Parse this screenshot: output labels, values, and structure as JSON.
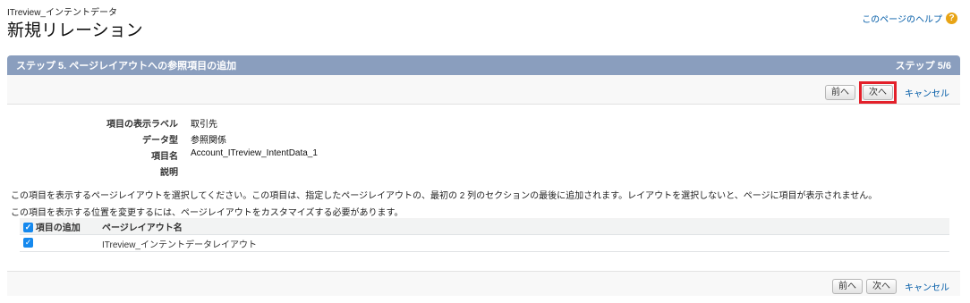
{
  "header": {
    "object_name": "ITreview_インテントデータ",
    "title": "新規リレーション",
    "help_link": "このページのヘルプ",
    "help_icon": "?"
  },
  "step": {
    "title": "ステップ 5. ページレイアウトへの参照項目の追加",
    "counter": "ステップ 5/6"
  },
  "buttons": {
    "prev": "前へ",
    "next": "次へ",
    "cancel": "キャンセル"
  },
  "details": {
    "label_field": "項目の表示ラベル",
    "value_field": "取引先",
    "label_type": "データ型",
    "value_type": "参照関係",
    "label_name": "項目名",
    "value_name": "Account_ITreview_IntentData_1",
    "label_desc": "説明",
    "value_desc": ""
  },
  "info": {
    "line1": "この項目を表示するページレイアウトを選択してください。この項目は、指定したページレイアウトの、最初の 2 列のセクションの最後に追加されます。レイアウトを選択しないと、ページに項目が表示されません。",
    "line2": "この項目を表示する位置を変更するには、ページレイアウトをカスタマイズする必要があります。"
  },
  "table": {
    "col_add": "項目の追加",
    "col_layout": "ページレイアウト名",
    "rows": [
      {
        "checked": true,
        "layout": "ITreview_インテントデータレイアウト"
      }
    ]
  },
  "colors": {
    "header_bar": "#8a9ebe",
    "highlight": "#e3202a",
    "link": "#015ba7",
    "checkbox": "#1589ee"
  }
}
